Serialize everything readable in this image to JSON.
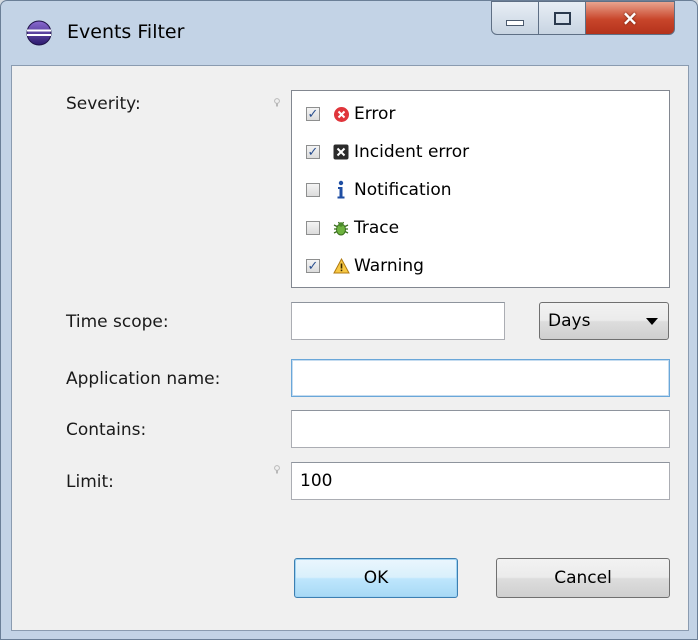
{
  "window": {
    "title": "Events Filter",
    "app_icon": "eclipse-icon",
    "controls": {
      "minimize": "minimize-icon",
      "maximize": "maximize-icon",
      "close": "×"
    }
  },
  "form": {
    "severity_label": "Severity:",
    "severity_options": [
      {
        "label": "Error",
        "checked": true,
        "icon": "error-icon",
        "color": "#e0353b"
      },
      {
        "label": "Incident error",
        "checked": true,
        "icon": "incident-error-icon",
        "color": "#2b2b2b"
      },
      {
        "label": "Notification",
        "checked": false,
        "icon": "info-icon",
        "color": "#1f4ea3"
      },
      {
        "label": "Trace",
        "checked": false,
        "icon": "bug-icon",
        "color": "#4a8a2a"
      },
      {
        "label": "Warning",
        "checked": true,
        "icon": "warning-icon",
        "color": "#e8a317"
      }
    ],
    "time_scope_label": "Time scope:",
    "time_scope_value": "",
    "time_unit": "Days",
    "application_name_label": "Application name:",
    "application_name_value": "",
    "contains_label": "Contains:",
    "contains_value": "",
    "limit_label": "Limit:",
    "limit_value": "100"
  },
  "buttons": {
    "ok": "OK",
    "cancel": "Cancel"
  },
  "colors": {
    "accent": "#3c7fb1",
    "window_frame": "#c3d3e6"
  }
}
